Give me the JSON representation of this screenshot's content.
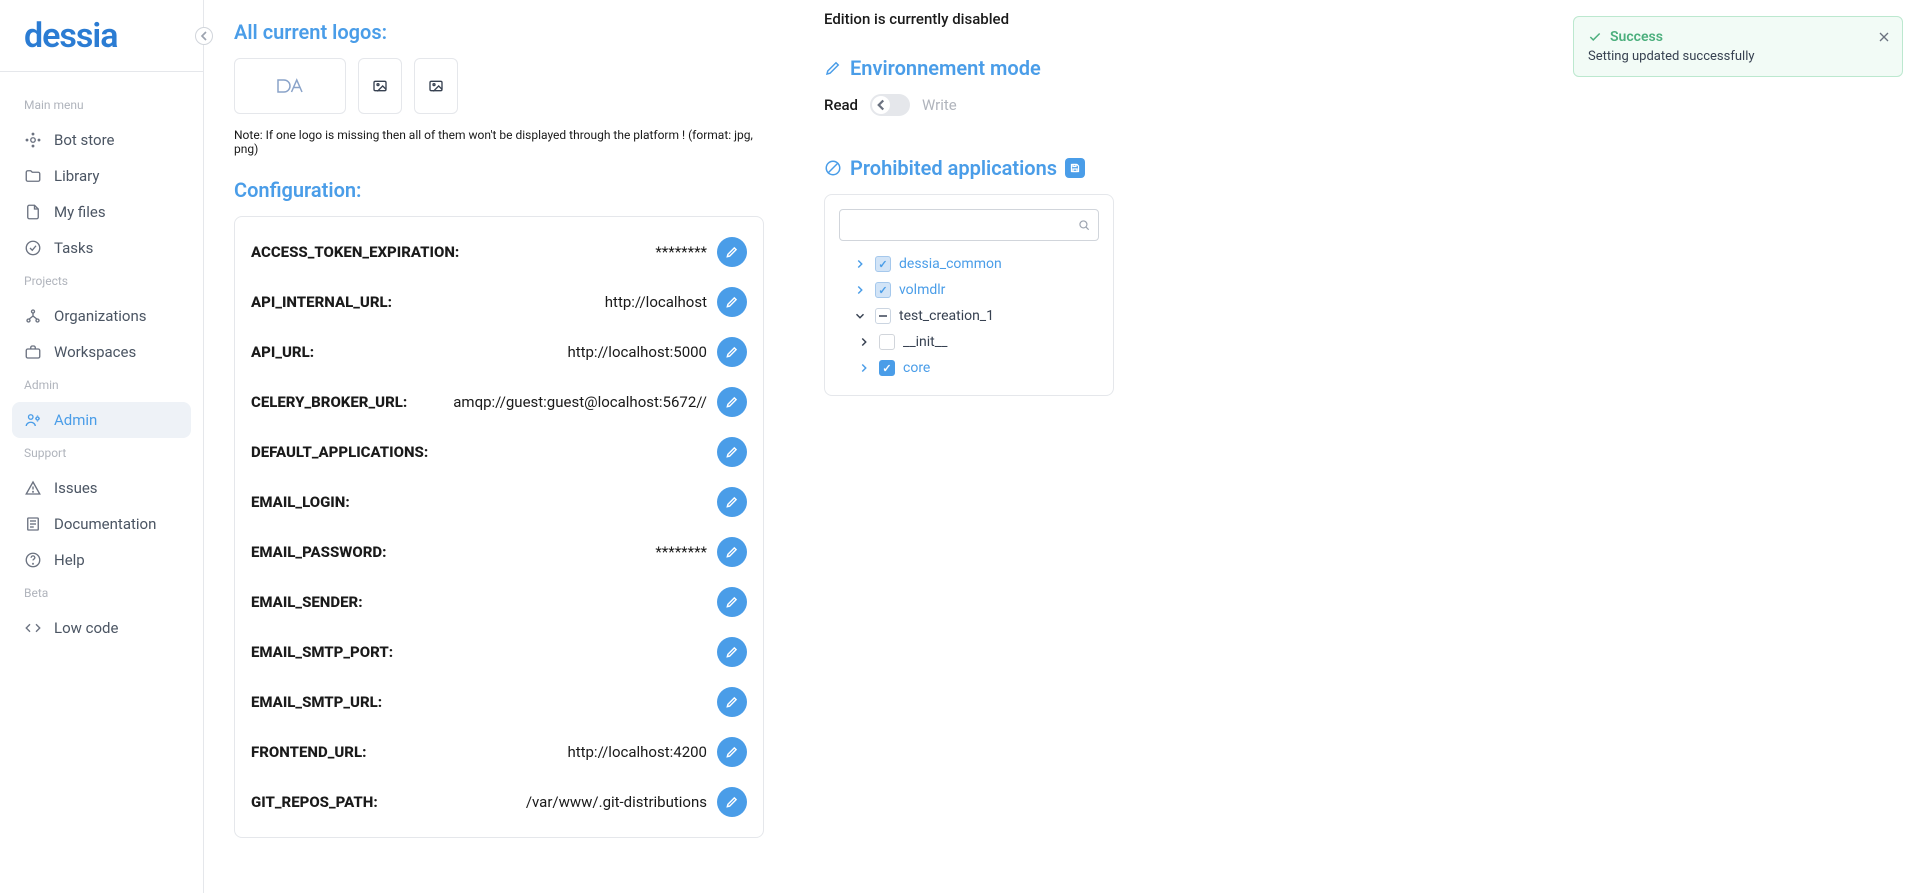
{
  "brand": "dessia",
  "sidebar": {
    "sections": {
      "main_menu": {
        "label": "Main menu",
        "items": [
          {
            "label": "Bot store"
          },
          {
            "label": "Library"
          },
          {
            "label": "My files"
          },
          {
            "label": "Tasks"
          }
        ]
      },
      "projects": {
        "label": "Projects",
        "items": [
          {
            "label": "Organizations"
          },
          {
            "label": "Workspaces"
          }
        ]
      },
      "admin": {
        "label": "Admin",
        "items": [
          {
            "label": "Admin"
          }
        ]
      },
      "support": {
        "label": "Support",
        "items": [
          {
            "label": "Issues"
          },
          {
            "label": "Documentation"
          },
          {
            "label": "Help"
          }
        ]
      },
      "beta": {
        "label": "Beta",
        "items": [
          {
            "label": "Low code"
          }
        ]
      }
    }
  },
  "logos": {
    "title": "All current logos:",
    "note": "Note: If one logo is missing then all of them won't be displayed through the platform ! (format: jpg, png)"
  },
  "config": {
    "title": "Configuration:",
    "rows": [
      {
        "key": "ACCESS_TOKEN_EXPIRATION:",
        "value": "********"
      },
      {
        "key": "API_INTERNAL_URL:",
        "value": "http://localhost"
      },
      {
        "key": "API_URL:",
        "value": "http://localhost:5000"
      },
      {
        "key": "CELERY_BROKER_URL:",
        "value": "amqp://guest:guest@localhost:5672//"
      },
      {
        "key": "DEFAULT_APPLICATIONS:",
        "value": ""
      },
      {
        "key": "EMAIL_LOGIN:",
        "value": ""
      },
      {
        "key": "EMAIL_PASSWORD:",
        "value": "********"
      },
      {
        "key": "EMAIL_SENDER:",
        "value": ""
      },
      {
        "key": "EMAIL_SMTP_PORT:",
        "value": ""
      },
      {
        "key": "EMAIL_SMTP_URL:",
        "value": ""
      },
      {
        "key": "FRONTEND_URL:",
        "value": "http://localhost:4200"
      },
      {
        "key": "GIT_REPOS_PATH:",
        "value": "/var/www/.git-distributions"
      }
    ]
  },
  "right": {
    "disabled_note": "Edition is currently disabled",
    "env_mode_title": "Environnement mode",
    "read_label": "Read",
    "write_label": "Write",
    "prohibited_title": "Prohibited applications",
    "tree": {
      "dessia_common": "dessia_common",
      "volmdlr": "volmdlr",
      "test_creation_1": "test_creation_1",
      "init": "__init__",
      "core": "core"
    }
  },
  "toast": {
    "title": "Success",
    "msg": "Setting updated successfully"
  },
  "search": {
    "placeholder": ""
  }
}
